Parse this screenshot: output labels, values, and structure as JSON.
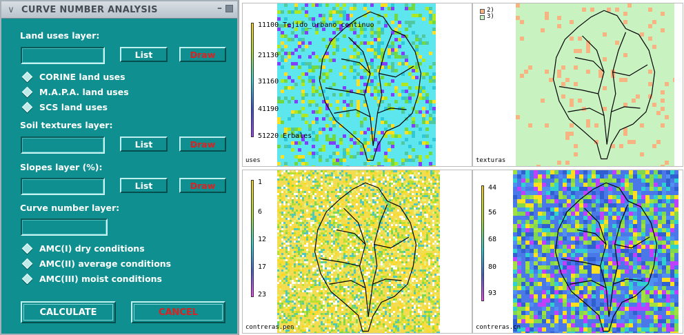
{
  "dialog": {
    "title": "CURVE NUMBER ANALYSIS",
    "land_uses_label": "Land uses layer:",
    "soil_label": "Soil textures layer:",
    "slopes_label": "Slopes layer (%):",
    "curve_label": "Curve number layer:",
    "list_label": "List",
    "draw_label": "Draw",
    "land_use_options": [
      "CORINE land uses",
      "M.A.P.A. land uses",
      "SCS land uses"
    ],
    "amc_options": [
      "AMC(I) dry conditions",
      "AMC(II) average conditions",
      "AMC(III) moist conditions"
    ],
    "calculate_label": "CALCULATE",
    "cancel_label": "CANCEL",
    "accent_bg": "#0f8f8f",
    "draw_color": "#e02020"
  },
  "maps": {
    "uses": {
      "caption": "uses",
      "legend": [
        "11100 Tejido_urbano_continuo",
        "21130",
        "31160",
        "41190",
        "51220 Erbales"
      ]
    },
    "texturas": {
      "caption": "texturas",
      "legend": [
        "2)",
        "3)"
      ]
    },
    "pen": {
      "caption": "contreras.pen",
      "legend": [
        "1",
        "6",
        "12",
        "17",
        "23"
      ]
    },
    "cn": {
      "caption": "contreras.cn",
      "legend": [
        "44",
        "56",
        "68",
        "80",
        "93"
      ]
    }
  }
}
